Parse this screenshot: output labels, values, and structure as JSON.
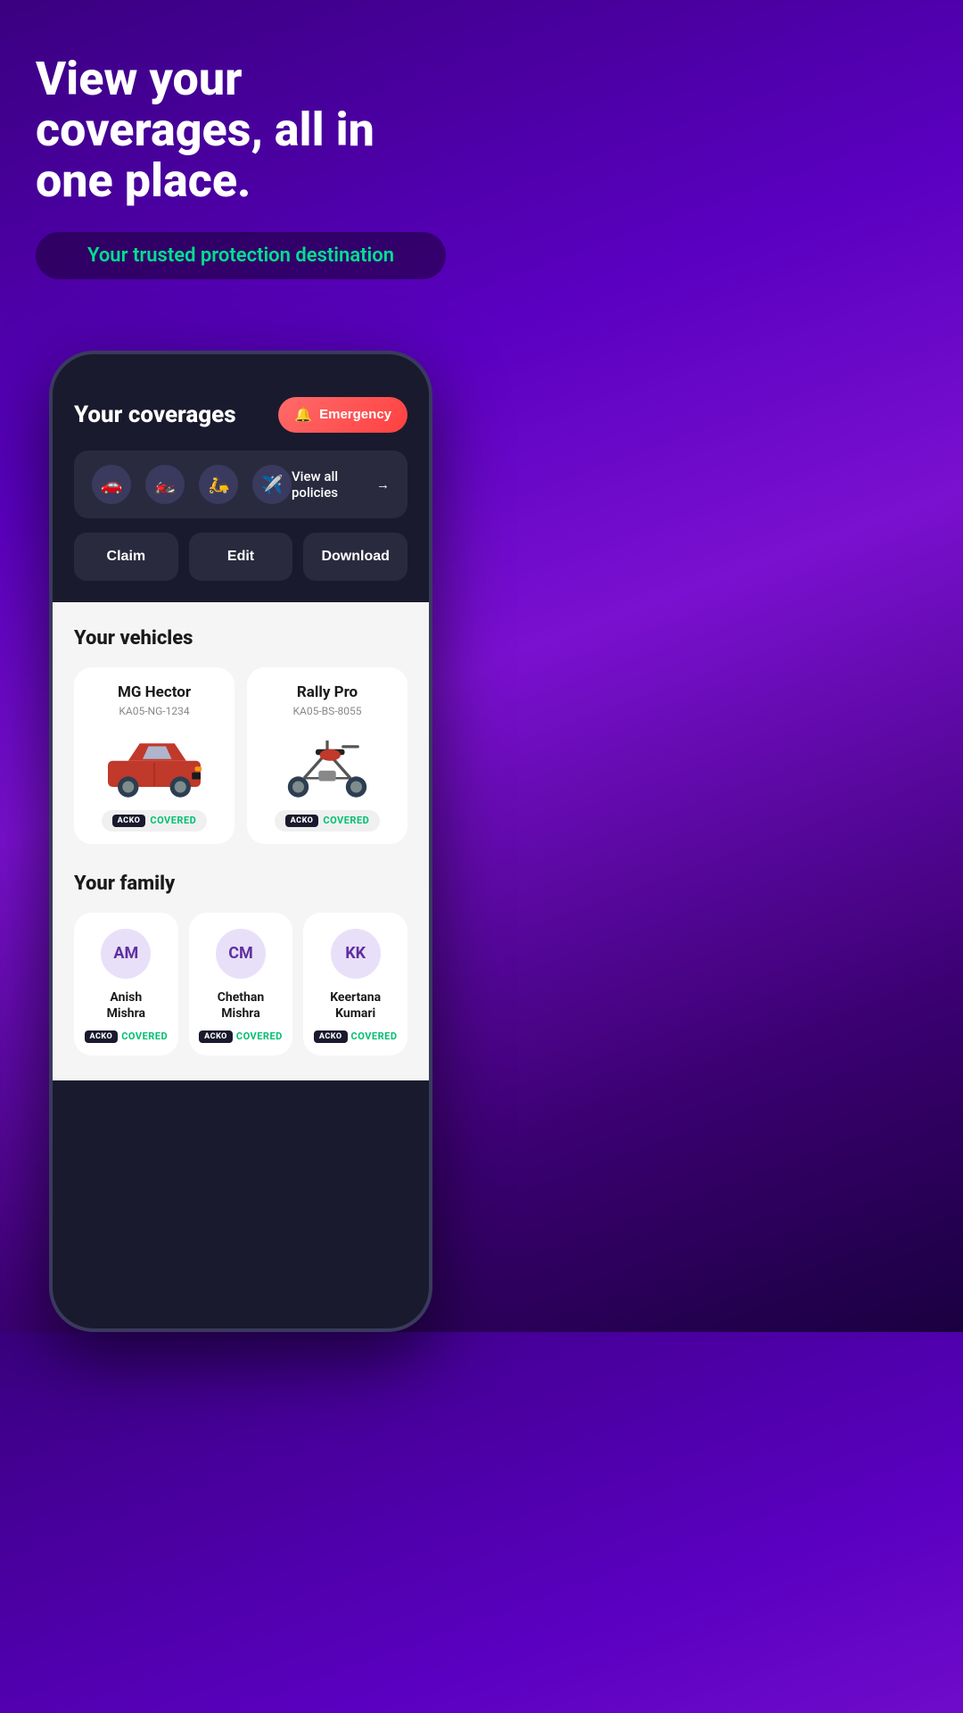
{
  "hero": {
    "title": "View your coverages, all in one place.",
    "subtitle": "Your trusted protection destination"
  },
  "app": {
    "coverages_title": "Your coverages",
    "emergency_label": "Emergency",
    "view_all_label": "View all policies",
    "policy_icons": [
      "🚗",
      "🏍️",
      "🛵",
      "✈️"
    ],
    "action_buttons": [
      "Claim",
      "Edit",
      "Download"
    ]
  },
  "vehicles": {
    "section_title": "Your vehicles",
    "items": [
      {
        "name": "MG Hector",
        "plate": "KA05-NG-1234",
        "type": "car",
        "brand": "ACKO",
        "status": "COVERED"
      },
      {
        "name": "Rally Pro",
        "plate": "KA05-BS-8055",
        "type": "bike",
        "brand": "ACKO",
        "status": "COVERED"
      }
    ]
  },
  "family": {
    "section_title": "Your family",
    "members": [
      {
        "initials": "AM",
        "name": "Anish Mishra",
        "brand": "ACKO",
        "status": "COVERED"
      },
      {
        "initials": "CM",
        "name": "Chethan Mishra",
        "brand": "ACKO",
        "status": "COVERED"
      },
      {
        "initials": "KK",
        "name": "Keertana Kumari",
        "brand": "ACKO",
        "status": "COVERED"
      }
    ]
  }
}
